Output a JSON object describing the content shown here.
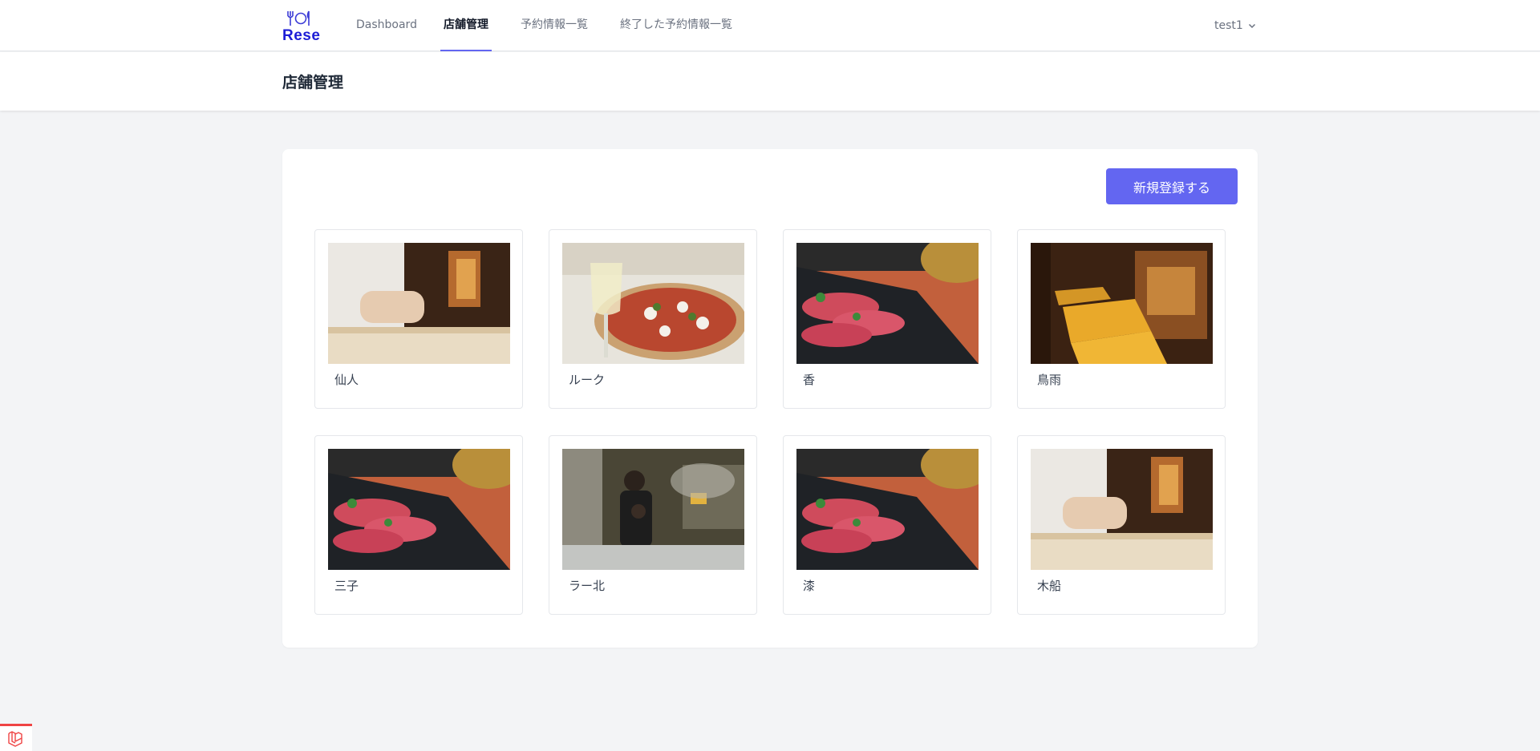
{
  "nav": {
    "logo_text": "Rese",
    "links": [
      {
        "label": "Dashboard",
        "active": false
      },
      {
        "label": "店舗管理",
        "active": true
      },
      {
        "label": "予約情報一覧",
        "active": false
      },
      {
        "label": "終了した予約情報一覧",
        "active": false
      }
    ],
    "user": "test1"
  },
  "header": {
    "title": "店舗管理"
  },
  "panel": {
    "new_button": "新規登録する",
    "shops": [
      {
        "name": "仙人",
        "image": "sushi-chef"
      },
      {
        "name": "ルーク",
        "image": "pizza-wine"
      },
      {
        "name": "香",
        "image": "yakiniku"
      },
      {
        "name": "鳥雨",
        "image": "dining-room"
      },
      {
        "name": "三子",
        "image": "yakiniku"
      },
      {
        "name": "ラー北",
        "image": "ramen-kitchen"
      },
      {
        "name": "漆",
        "image": "yakiniku"
      },
      {
        "name": "木船",
        "image": "sushi-chef"
      }
    ]
  },
  "colors": {
    "accent": "#6366f1",
    "logo": "#1d1dd6"
  }
}
